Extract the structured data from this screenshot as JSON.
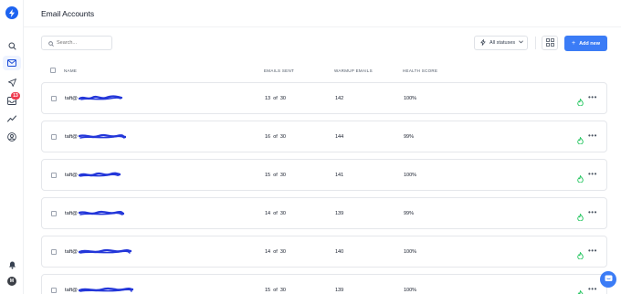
{
  "app": {
    "logo_icon": "bolt-icon",
    "accent": "#3b7cf6"
  },
  "sidebar": {
    "items": [
      {
        "name": "search",
        "icon": "search-icon"
      },
      {
        "name": "email-accounts",
        "icon": "mail-icon",
        "active": true
      },
      {
        "name": "campaigns",
        "icon": "send-icon"
      },
      {
        "name": "inbox",
        "icon": "inbox-icon",
        "badge": "13"
      },
      {
        "name": "analytics",
        "icon": "chart-icon"
      },
      {
        "name": "contacts",
        "icon": "user-circle-icon"
      }
    ],
    "bottom": {
      "notifications_icon": "bell-icon",
      "avatar_initial": "M"
    }
  },
  "header": {
    "title": "Email Accounts"
  },
  "toolbar": {
    "search_placeholder": "Search...",
    "status_filter": "All statuses",
    "add_label": "Add new",
    "add_plus": "+"
  },
  "table": {
    "columns": {
      "name": "NAME",
      "sent": "EMAILS SENT",
      "warmup": "WARMUP EMAILS",
      "health": "HEALTH SCORE"
    },
    "rows": [
      {
        "email_prefix": "taft@",
        "sent": "13",
        "of_label": "of",
        "limit": "30",
        "warmup": "142",
        "health": "100%"
      },
      {
        "email_prefix": "taft@",
        "sent": "16",
        "of_label": "of",
        "limit": "30",
        "warmup": "144",
        "health": "99%"
      },
      {
        "email_prefix": "taft@",
        "sent": "15",
        "of_label": "of",
        "limit": "30",
        "warmup": "141",
        "health": "100%"
      },
      {
        "email_prefix": "taft@",
        "sent": "14",
        "of_label": "of",
        "limit": "30",
        "warmup": "139",
        "health": "99%"
      },
      {
        "email_prefix": "taft@",
        "sent": "14",
        "of_label": "of",
        "limit": "30",
        "warmup": "140",
        "health": "100%"
      },
      {
        "email_prefix": "taft@",
        "sent": "15",
        "of_label": "of",
        "limit": "30",
        "warmup": "139",
        "health": "100%"
      }
    ],
    "row_action_icon": "flame-icon",
    "row_menu_icon": "more-horizontal-icon"
  }
}
